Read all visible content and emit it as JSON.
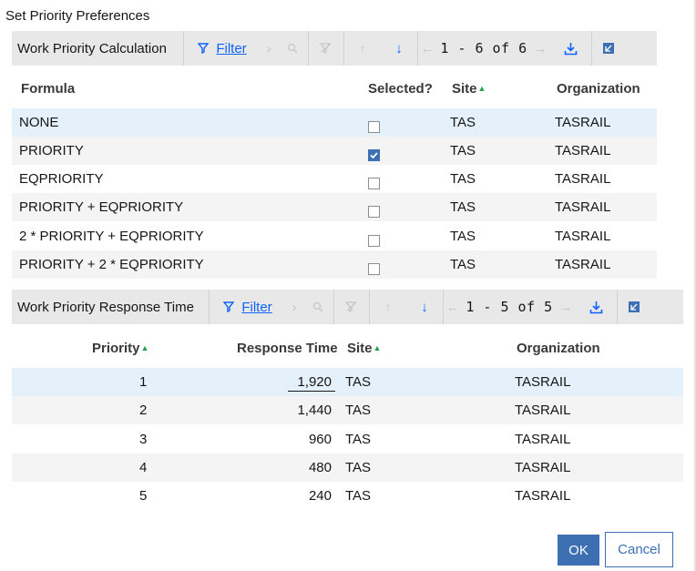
{
  "dialog": {
    "title": "Set Priority Preferences"
  },
  "table1": {
    "title": "Work Priority Calculation",
    "filter_label": "Filter",
    "pager": "1 - 6 of 6",
    "columns": {
      "formula": "Formula",
      "selected": "Selected?",
      "site": "Site",
      "organization": "Organization"
    },
    "rows": [
      {
        "formula": "NONE",
        "selected": false,
        "site": "TAS",
        "organization": "TASRAIL"
      },
      {
        "formula": "PRIORITY",
        "selected": true,
        "site": "TAS",
        "organization": "TASRAIL"
      },
      {
        "formula": "EQPRIORITY",
        "selected": false,
        "site": "TAS",
        "organization": "TASRAIL"
      },
      {
        "formula": "PRIORITY + EQPRIORITY",
        "selected": false,
        "site": "TAS",
        "organization": "TASRAIL"
      },
      {
        "formula": "2 * PRIORITY + EQPRIORITY",
        "selected": false,
        "site": "TAS",
        "organization": "TASRAIL"
      },
      {
        "formula": "PRIORITY + 2 * EQPRIORITY",
        "selected": false,
        "site": "TAS",
        "organization": "TASRAIL"
      }
    ]
  },
  "table2": {
    "title": "Work Priority Response Time",
    "filter_label": "Filter",
    "pager": "1 - 5 of 5",
    "columns": {
      "priority": "Priority",
      "response": "Response Time",
      "site": "Site",
      "organization": "Organization"
    },
    "rows": [
      {
        "priority": "1",
        "response": "1,920",
        "site": "TAS",
        "organization": "TASRAIL"
      },
      {
        "priority": "2",
        "response": "1,440",
        "site": "TAS",
        "organization": "TASRAIL"
      },
      {
        "priority": "3",
        "response": "960",
        "site": "TAS",
        "organization": "TASRAIL"
      },
      {
        "priority": "4",
        "response": "480",
        "site": "TAS",
        "organization": "TASRAIL"
      },
      {
        "priority": "5",
        "response": "240",
        "site": "TAS",
        "organization": "TASRAIL"
      }
    ]
  },
  "buttons": {
    "ok": "OK",
    "cancel": "Cancel"
  },
  "colors": {
    "accent": "#0f62fe",
    "button": "#3d70b2",
    "selected_row": "#e4f1fa",
    "sort_arrow": "#24a148"
  }
}
